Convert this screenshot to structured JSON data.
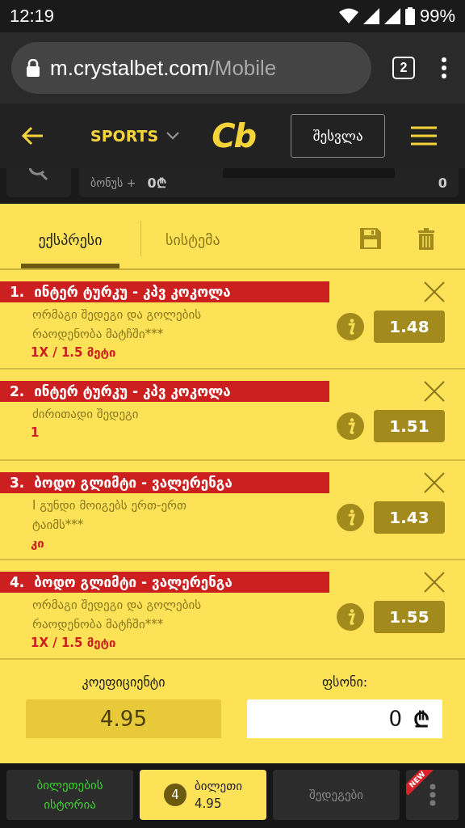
{
  "status_bar": {
    "time": "12:19",
    "battery": "99%"
  },
  "browser": {
    "url": "m.crystalbet.com/Mobile",
    "tab_count": "2"
  },
  "header": {
    "sports_label": "SPORTS",
    "logo": "Cb",
    "login_button": "შესვლა"
  },
  "balance_row": {
    "label": "ბონუს +",
    "amount": "0₾",
    "count": "0"
  },
  "tabs": [
    {
      "label": "ექსპრესი",
      "selected": true
    },
    {
      "label": "სისტემა",
      "selected": false
    }
  ],
  "bets": [
    {
      "number": "1.",
      "match": "ინტერ ტურკუ - კპვ კოკოლა",
      "market": "ორმაგი შედეგი და გოლების რაოდენობა მატჩში***",
      "selection": "1X / 1.5 მეტი",
      "odds": "1.48"
    },
    {
      "number": "2.",
      "match": "ინტერ ტურკუ - კპვ კოკოლა",
      "market": "ძირითადი შედეგი",
      "selection": "1",
      "odds": "1.51"
    },
    {
      "number": "3.",
      "match": "ბოდო გლიმტი - ვალერენგა",
      "market": "I გუნდი მოიგებს ერთ-ერთ ტაიმს***",
      "selection": "კი",
      "odds": "1.43"
    },
    {
      "number": "4.",
      "match": "ბოდო გლიმტი - ვალერენგა",
      "market": "ორმაგი შედეგი და გოლების რაოდენობა მატჩში***",
      "selection": "1X / 1.5 მეტი",
      "odds": "1.55"
    }
  ],
  "summary": {
    "odds_label": "კოეფიციენტი",
    "total_odds": "4.95",
    "stake_label": "ფსონი:",
    "stake_value": "0",
    "currency": "₾"
  },
  "bottom_nav": [
    {
      "kind": "history",
      "label": "ბილეთების ისტორია",
      "selected": false
    },
    {
      "kind": "ticket",
      "count": "4",
      "label": "ბილეთი",
      "odds": "4.95",
      "selected": true
    },
    {
      "kind": "results",
      "label": "შედეგები",
      "selected": false
    },
    {
      "kind": "more",
      "badge": "NEW",
      "selected": false
    }
  ]
}
